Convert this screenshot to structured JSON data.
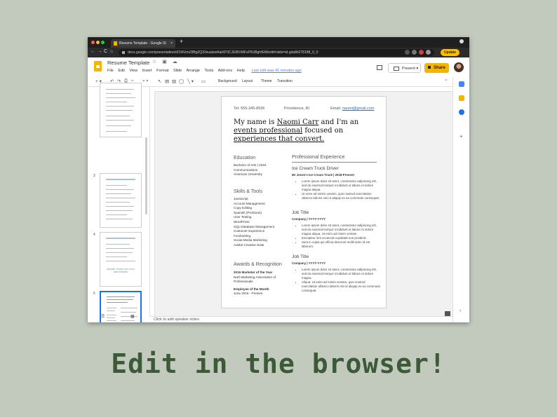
{
  "browser": {
    "tab_title": "Resume Template - Google Sl",
    "tab_close": "×",
    "new_tab": "+",
    "url": "docs.google.com/presentation/d/1WUmZ8Bg2Q33xualseiAatXP3CJEBIXMFsP9UBghfEM/edit#slide=id.gda8b278188_0_0",
    "update_label": "Update",
    "nav_back": "←",
    "nav_forward": "→",
    "nav_reload": "C",
    "nav_home": "⌂"
  },
  "doc": {
    "title": "Resume Template",
    "menus": [
      "File",
      "Edit",
      "View",
      "Insert",
      "Format",
      "Slide",
      "Arrange",
      "Tools",
      "Add-ons",
      "Help"
    ],
    "last_edit": "Last edit was 41 minutes ago",
    "present_label": "Present",
    "share_label": "Share"
  },
  "toolbar": {
    "background": "Background",
    "layout": "Layout",
    "theme": "Theme",
    "transition": "Transition"
  },
  "filmstrip": {
    "numbers": [
      "3",
      "4",
      "5"
    ],
    "thumb4_caption": "Michael Jordan who once was fantastic"
  },
  "resume": {
    "phone": "Tel: 555-345-8936",
    "location": "Providence, RI",
    "email_label": "Email:",
    "email": "naomi@gmail.com",
    "intro_1": "My name is ",
    "intro_name": "Naomi Carr",
    "intro_2": " and I'm an ",
    "intro_events": "events professional",
    "intro_3": " focused on ",
    "intro_exp": "experiences that convert.",
    "education_heading": "Education",
    "education_lines": [
      "Bachelor of Arts | 2015",
      "Communications",
      "American University"
    ],
    "skills_heading": "Skills & Tools",
    "skills": [
      "Javascript",
      "Account Management",
      "Copy Editing",
      "Spanish (Proficient)",
      "User Testing",
      "WordPress",
      "SQL Database Management",
      "Customer Experience",
      "Fundraising",
      "Social Media Marketing",
      "Adobe Creative Suite"
    ],
    "awards_heading": "Awards & Recognition",
    "award1_title": "2016 Marketer of the Year",
    "award1_lines": [
      "Nat'l Marketing Association of",
      "Professionals"
    ],
    "award2_title": "Employee of the Month",
    "award2_line": "June 2015 - Present",
    "experience_heading": "Professional Experience",
    "jobs": [
      {
        "title": "Ice Cream Truck Driver",
        "company": "Mr Jones's Ice Cream Truck | 2018-Present",
        "bullets": [
          "Lorem ipsum dolor sit amet, consectetur adipiscing elit, sed do eiusmod tempor incididunt ut labore et dolore magna aliqua.",
          "Ut enim ad minim veniam, quis nostrud exercitation ullamco laboris nisi ut aliquip ex ea commodo consequat."
        ]
      },
      {
        "title": "Job Title",
        "company": "Company | YYYY-YYYY",
        "bullets": [
          "Lorem ipsum dolor sit amet, consectetur adipiscing elit, sed do eiusmod tempor incididunt ut labore et dolore magna aliqua. Ut enim ad minim veniam.",
          "Excepteur sint occaecat cupidatat non proident.",
          "Sunt in culpa qui officia deserunt mollit anim id est laborum."
        ]
      },
      {
        "title": "Job Title",
        "company": "Company | YYYY-YYYY",
        "bullets": [
          "Lorem ipsum dolor sit amet, consectetur adipiscing elit, sed do eiusmod tempor incididunt ut labore et dolore magna.",
          "Aliqua. Ut enim ad minim veniam, quis nostrud exercitation ullamco laboris nisi ut aliquip ex ea commodo consequat."
        ]
      }
    ]
  },
  "notes_placeholder": "Click to add speaker notes",
  "caption": "Edit in the browser!",
  "colors": {
    "background": "#c2cabd",
    "caption": "#3d5a38",
    "accent": "#f4b400",
    "link": "#1a73e8"
  }
}
